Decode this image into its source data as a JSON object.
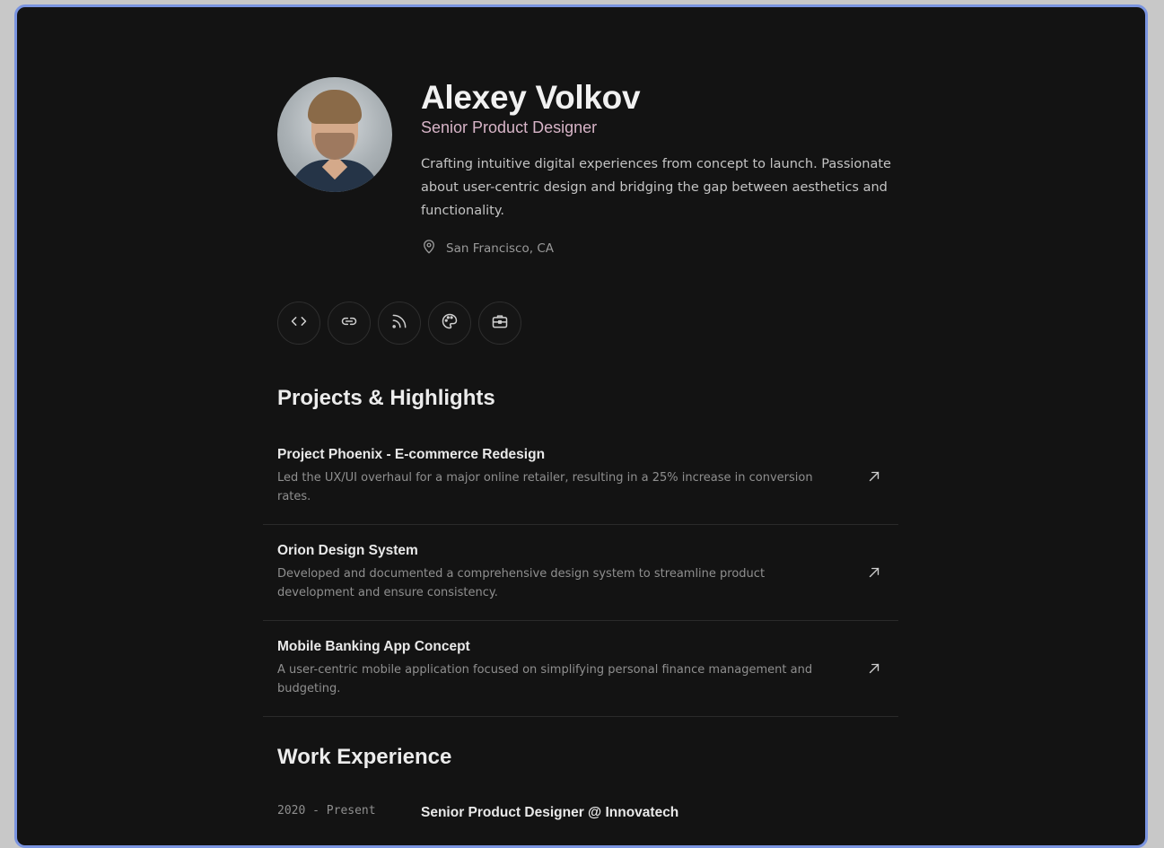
{
  "profile": {
    "name": "Alexey Volkov",
    "role": "Senior Product Designer",
    "bio": "Crafting intuitive digital experiences from concept to launch. Passionate about user-centric design and bridging the gap between aesthetics and functionality.",
    "location": "San Francisco, CA",
    "avatar_alt": "Portrait photo"
  },
  "socials": [
    {
      "icon": "code-icon"
    },
    {
      "icon": "link-icon"
    },
    {
      "icon": "rss-icon"
    },
    {
      "icon": "palette-icon"
    },
    {
      "icon": "briefcase-icon"
    }
  ],
  "projects_section": {
    "title": "Projects & Highlights",
    "items": [
      {
        "title": "Project Phoenix - E-commerce Redesign",
        "description": "Led the UX/UI overhaul for a major online retailer, resulting in a 25% increase in conversion rates."
      },
      {
        "title": "Orion Design System",
        "description": "Developed and documented a comprehensive design system to streamline product development and ensure consistency."
      },
      {
        "title": "Mobile Banking App Concept",
        "description": "A user-centric mobile application focused on simplifying personal finance management and budgeting."
      }
    ]
  },
  "experience_section": {
    "title": "Work Experience",
    "items": [
      {
        "period": "2020 - Present",
        "title": "Senior Product Designer @ Innovatech"
      }
    ]
  },
  "colors": {
    "background": "#131313",
    "window_border": "#7a94e0",
    "role_accent": "#d7b4c7"
  }
}
